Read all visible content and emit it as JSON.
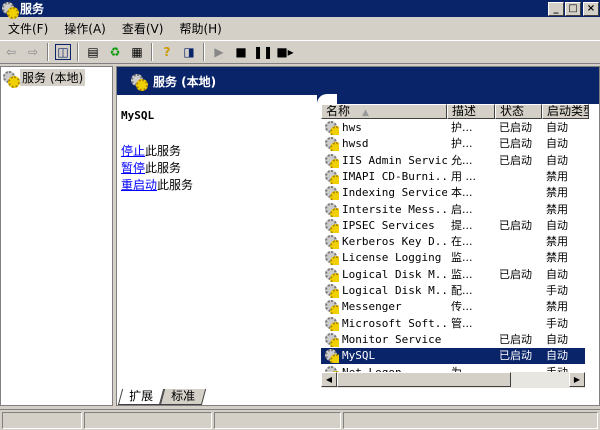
{
  "window": {
    "title": "服务",
    "minimize": "_",
    "maximize": "□",
    "close": "×"
  },
  "menu": [
    "文件(F)",
    "操作(A)",
    "查看(V)",
    "帮助(H)"
  ],
  "toolbar": [
    "back-icon",
    "forward-icon",
    "show-hide-tree-icon",
    "properties-icon",
    "refresh-icon",
    "export-list-icon",
    "help-icon",
    "show-hide-action-pane-icon",
    "start-icon",
    "stop-icon",
    "pause-icon",
    "restart-icon"
  ],
  "tree": {
    "root": "服务 (本地)"
  },
  "header": {
    "title": "服务 (本地)"
  },
  "details": {
    "service_name": "MySQL",
    "actions": [
      {
        "link": "停止",
        "text": "此服务"
      },
      {
        "link": "暂停",
        "text": "此服务"
      },
      {
        "link": "重启动",
        "text": "此服务"
      }
    ]
  },
  "list": {
    "columns": [
      "名称",
      "描述",
      "状态",
      "启动类型"
    ],
    "sort_indicator": "▲",
    "rows": [
      {
        "name": "hws",
        "desc": "护...",
        "status": "已启动",
        "startup": "自动"
      },
      {
        "name": "hwsd",
        "desc": "护...",
        "status": "已启动",
        "startup": "自动"
      },
      {
        "name": "IIS Admin Service",
        "desc": "允...",
        "status": "已启动",
        "startup": "自动"
      },
      {
        "name": "IMAPI CD-Burni...",
        "desc": "用 ...",
        "status": "",
        "startup": "禁用"
      },
      {
        "name": "Indexing Service",
        "desc": "本...",
        "status": "",
        "startup": "禁用"
      },
      {
        "name": "Intersite Mess...",
        "desc": "启...",
        "status": "",
        "startup": "禁用"
      },
      {
        "name": "IPSEC Services",
        "desc": "提...",
        "status": "已启动",
        "startup": "自动"
      },
      {
        "name": "Kerberos Key D...",
        "desc": "在...",
        "status": "",
        "startup": "禁用"
      },
      {
        "name": "License Logging",
        "desc": "监...",
        "status": "",
        "startup": "禁用"
      },
      {
        "name": "Logical Disk M...",
        "desc": "监...",
        "status": "已启动",
        "startup": "自动"
      },
      {
        "name": "Logical Disk M...",
        "desc": "配...",
        "status": "",
        "startup": "手动"
      },
      {
        "name": "Messenger",
        "desc": "传...",
        "status": "",
        "startup": "禁用"
      },
      {
        "name": "Microsoft Soft...",
        "desc": "管...",
        "status": "",
        "startup": "手动"
      },
      {
        "name": "Monitor Service",
        "desc": "",
        "status": "已启动",
        "startup": "自动"
      },
      {
        "name": "MySQL",
        "desc": "",
        "status": "已启动",
        "startup": "自动",
        "selected": true
      },
      {
        "name": "Net Logon",
        "desc": "为...",
        "status": "",
        "startup": "手动"
      }
    ]
  },
  "tabs": [
    "扩展",
    "标准"
  ],
  "colors": {
    "titlebar": "#0a246a",
    "selection": "#0a246a",
    "link": "#0000ff"
  }
}
